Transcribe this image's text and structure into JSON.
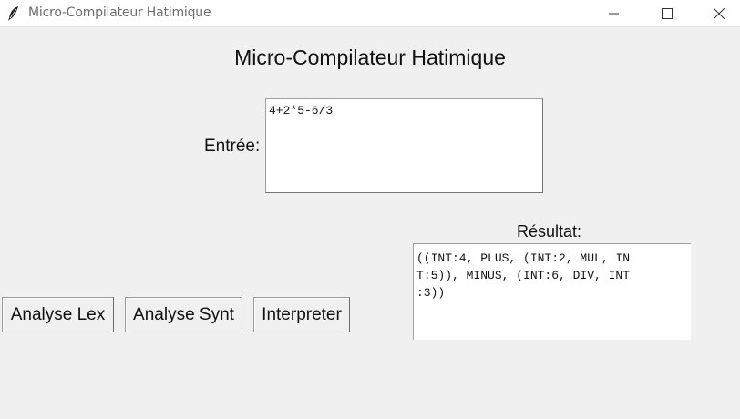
{
  "window": {
    "title": "Micro-Compilateur Hatimique",
    "icon": "feather-icon",
    "controls": [
      "minimize-icon",
      "maximize-icon",
      "close-icon"
    ]
  },
  "main": {
    "heading": "Micro-Compilateur Hatimique",
    "input_label": "Entrée:",
    "input_value": "4+2*5-6/3",
    "result_label": "Résultat:",
    "result_text": "((INT:4, PLUS, (INT:2, MUL, IN\nT:5)), MINUS, (INT:6, DIV, INT\n:3))"
  },
  "buttons": {
    "lex": "Analyse Lex",
    "synt": "Analyse Synt",
    "interp": "Interpreter"
  }
}
